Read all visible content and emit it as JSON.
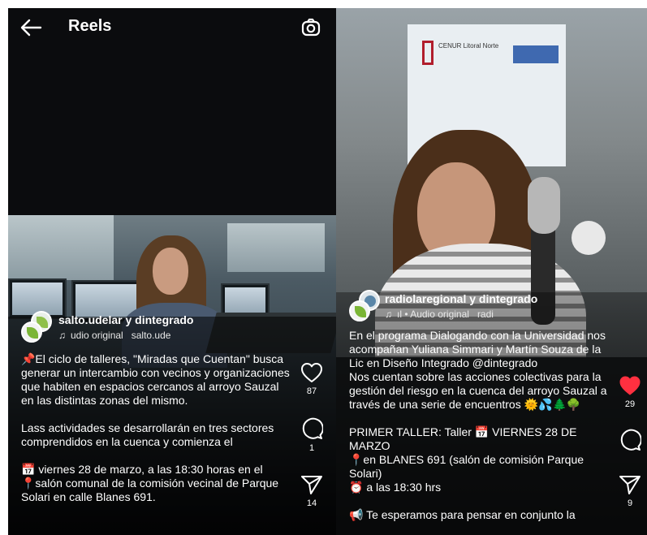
{
  "left": {
    "header": {
      "title": "Reels"
    },
    "post": {
      "accounts": "salto.udelar y dintegrado",
      "audio_text": "udio original",
      "audio_account": "salto.ude",
      "caption": "📌El ciclo de talleres, \"Miradas que Cuentan\" busca generar un intercambio con vecinos y organizaciones que habiten en espacios cercanos al arroyo Sauzal en las distintas zonas del mismo.\n\nLass actividades se desarrollarán en tres sectores comprendidos en la cuenca y comienza el\n\n📅 viernes 28 de marzo, a las 18:30 horas en el\n📍salón comunal de la comisión vecinal de Parque Solari en calle Blanes 691."
    },
    "actions": {
      "likes": "87",
      "comments": "1",
      "shares": "14"
    }
  },
  "right": {
    "post": {
      "accounts": "radiolaregional y dintegrado",
      "audio_prefix": "ıl • Audio original",
      "audio_account": "radi",
      "caption": "En el programa Dialogando con la Universidad nos acompañan Yuliana Simmari y Martín Souza de la Lic en Diseño Integrado @dintegrado\nNos cuentan sobre las acciones colectivas para la gestión del riesgo en la cuenca del arroyo Sauzal a través de una serie de encuentros 🌞💦🌲🌳\n\nPRIMER TALLER: Taller 📅 VIERNES 28 DE MARZO\n📍en BLANES 691 (salón de comisión Parque Solari)\n⏰ a las 18:30 hrs\n\n📢 Te esperamos para pensar en conjunto la"
    },
    "actions": {
      "likes": "29",
      "comments": "",
      "shares": "9"
    },
    "banner_text": "CENUR Litoral Norte"
  },
  "icons": {
    "back": "arrow-left-icon",
    "camera": "camera-icon",
    "heart": "heart-icon",
    "comment": "comment-icon",
    "share": "send-icon",
    "audio": "music-note-icon"
  },
  "colors": {
    "like_active": "#ff3040",
    "background": "#0b0c0e",
    "text": "#ffffff"
  }
}
